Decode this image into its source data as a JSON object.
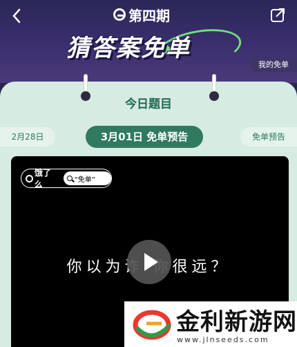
{
  "header": {
    "back_icon": "chevron-left-icon",
    "issue": "第四期",
    "title": "猜答案免单",
    "share_icon": "share-icon",
    "my_free": "我的免单"
  },
  "card": {
    "heading": "今日题目",
    "prev_date": "2月28日",
    "current_date": "3月01日 免单预告",
    "next_label": "免单预告"
  },
  "video": {
    "brand": "饿了么",
    "search_text": "“免单”",
    "caption": "你以为诈        你很远？",
    "play_icon": "play-icon"
  },
  "watermark": {
    "name": "金利新游网",
    "url": "www.jlnseeds.com"
  },
  "colors": {
    "header_bg": "#2a2758",
    "card_bg": "#d6ebe2",
    "accent_green": "#2f7a60",
    "ring_green": "#6ee07a"
  }
}
